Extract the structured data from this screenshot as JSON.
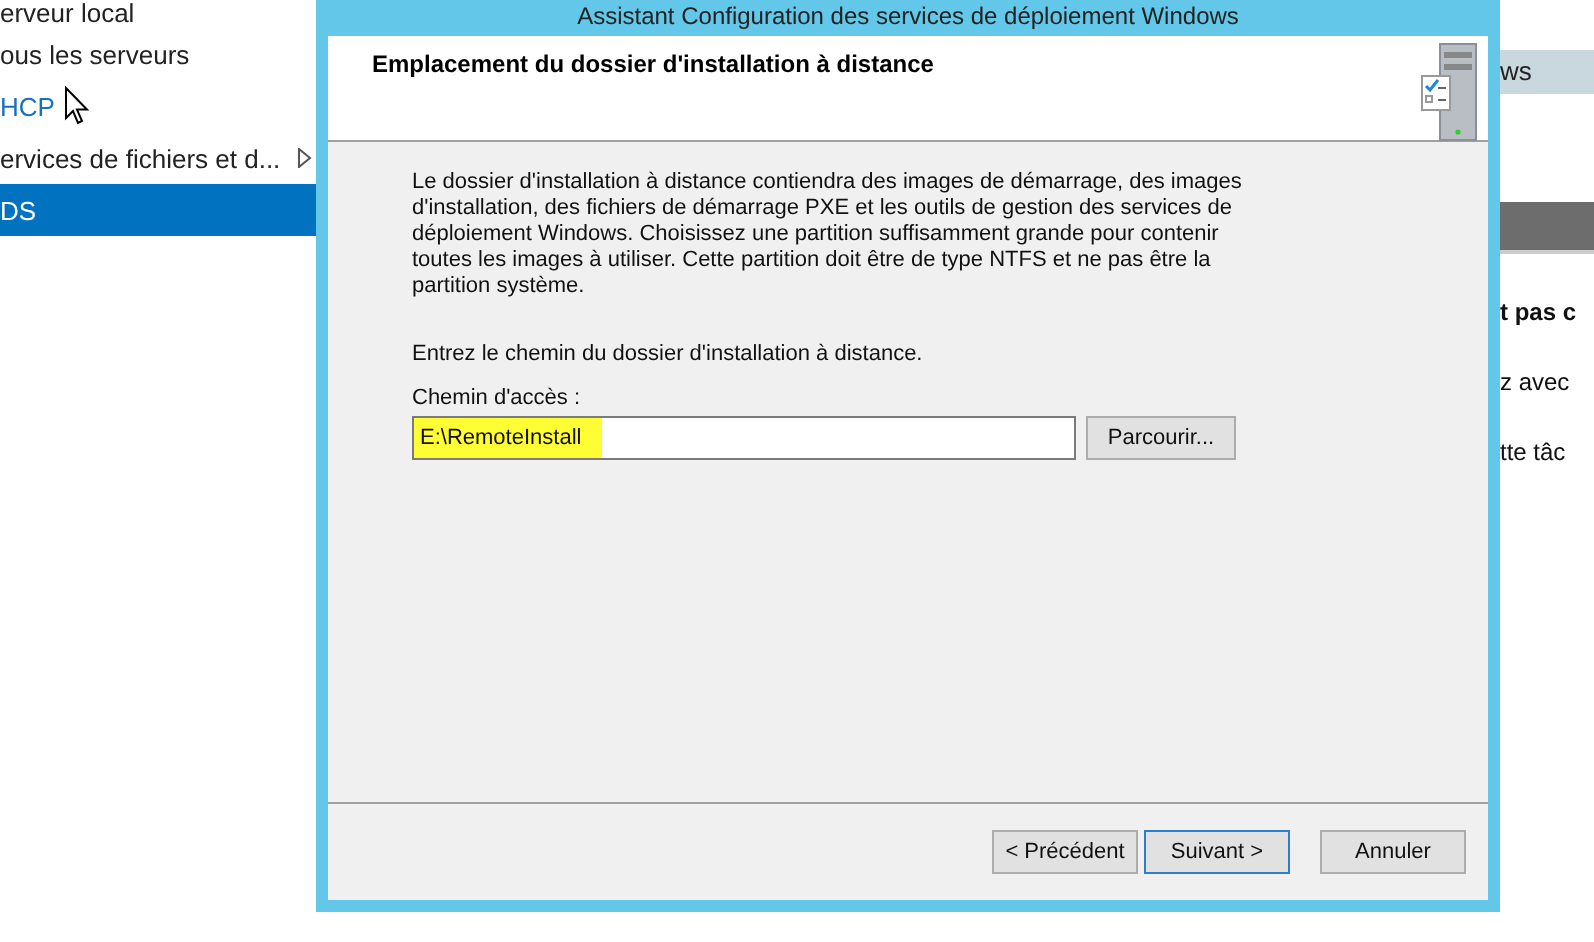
{
  "sidebar": {
    "items": [
      {
        "label": "erveur local",
        "selected": false,
        "submenu": false
      },
      {
        "label": "ous les serveurs",
        "selected": false,
        "submenu": false
      },
      {
        "label": "HCP",
        "selected": false,
        "submenu": false
      },
      {
        "label": "ervices de fichiers et d...",
        "selected": false,
        "submenu": true
      },
      {
        "label": "DS",
        "selected": true,
        "submenu": false
      }
    ]
  },
  "dialog": {
    "title": "Assistant Configuration des services de déploiement Windows",
    "heading": "Emplacement du dossier d'installation à distance",
    "description": "Le dossier d'installation à distance contiendra des images de démarrage, des images d'installation, des fichiers de démarrage PXE et les outils de gestion des services de déploiement Windows.  Choisissez une partition suffisamment grande pour contenir toutes les images à utiliser. Cette partition doit être de type NTFS et ne pas être la partition système.",
    "prompt": "Entrez le chemin du dossier d'installation à distance.",
    "path_label": "Chemin d'accès :",
    "path_value": "E:\\RemoteInstall",
    "browse_button": "Parcourir...",
    "buttons": [
      {
        "label": "< Précédent",
        "default": false
      },
      {
        "label": "Suivant >",
        "default": true
      },
      {
        "label": "Annuler",
        "default": false
      }
    ]
  },
  "background_panel": {
    "tab": "ws",
    "lines": [
      {
        "text": "t pas c",
        "bold": true
      },
      {
        "text": "z avec",
        "bold": false
      },
      {
        "text": "tte tâc",
        "bold": false
      }
    ]
  }
}
